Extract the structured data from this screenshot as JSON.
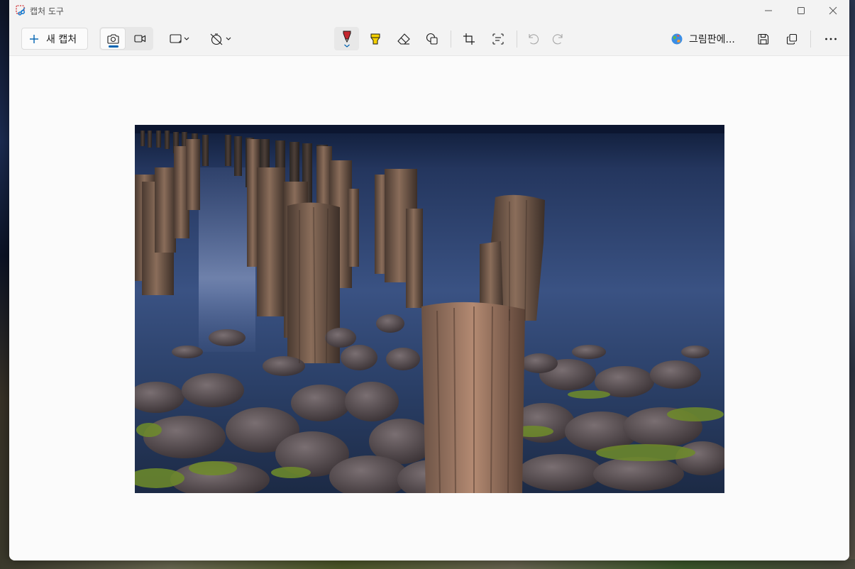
{
  "window": {
    "title": "캡처 도구"
  },
  "toolbar": {
    "new_capture_label": "새 캡처",
    "open_in_paint_label": "그림판에..."
  },
  "icons": {
    "app": "snipping-tool-icon",
    "minimize": "minimize-icon",
    "maximize": "maximize-icon",
    "close": "close-icon",
    "new": "plus-icon",
    "screenshot_mode": "camera-icon",
    "recording_mode": "video-camera-icon",
    "snip_shape": "rectangle-snip-icon",
    "delay": "timer-off-icon",
    "pen": "ballpoint-pen-icon",
    "highlighter": "highlighter-icon",
    "eraser": "eraser-icon",
    "shapes": "shapes-icon",
    "crop": "crop-icon",
    "text_actions": "text-actions-icon",
    "undo": "undo-icon",
    "redo": "redo-icon",
    "save": "save-icon",
    "copy": "copy-icon",
    "more": "more-icon"
  },
  "colors": {
    "accent": "#0063b1",
    "pen_color": "#c4262e",
    "highlighter_color": "#f5d100"
  }
}
